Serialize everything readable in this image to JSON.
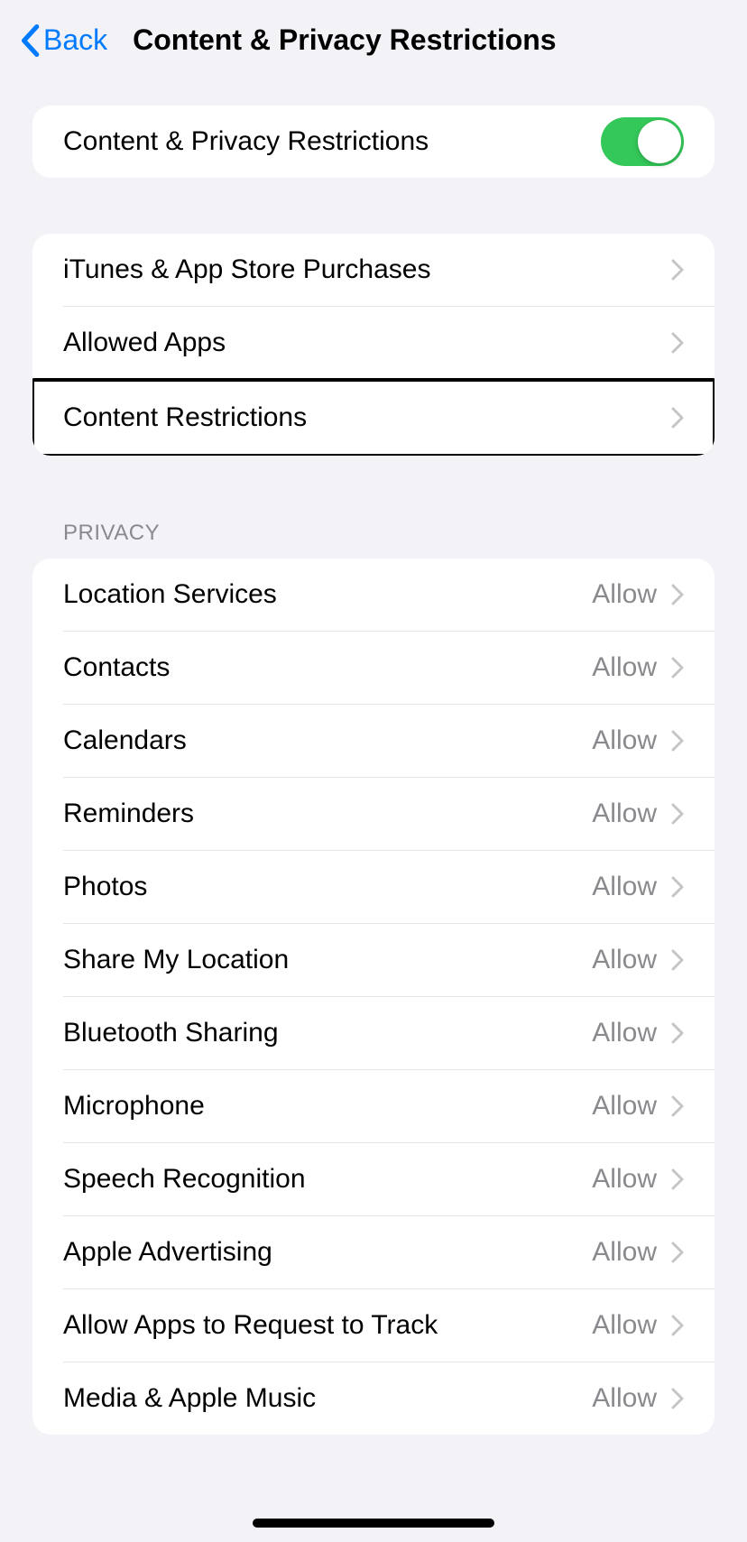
{
  "header": {
    "back_label": "Back",
    "title": "Content & Privacy Restrictions"
  },
  "toggle_section": {
    "label": "Content & Privacy Restrictions",
    "enabled": true
  },
  "nav_section": {
    "items": [
      {
        "label": "iTunes & App Store Purchases"
      },
      {
        "label": "Allowed Apps"
      },
      {
        "label": "Content Restrictions",
        "highlighted": true
      }
    ]
  },
  "privacy_section": {
    "header": "Privacy",
    "items": [
      {
        "label": "Location Services",
        "value": "Allow"
      },
      {
        "label": "Contacts",
        "value": "Allow"
      },
      {
        "label": "Calendars",
        "value": "Allow"
      },
      {
        "label": "Reminders",
        "value": "Allow"
      },
      {
        "label": "Photos",
        "value": "Allow"
      },
      {
        "label": "Share My Location",
        "value": "Allow"
      },
      {
        "label": "Bluetooth Sharing",
        "value": "Allow"
      },
      {
        "label": "Microphone",
        "value": "Allow"
      },
      {
        "label": "Speech Recognition",
        "value": "Allow"
      },
      {
        "label": "Apple Advertising",
        "value": "Allow"
      },
      {
        "label": "Allow Apps to Request to Track",
        "value": "Allow"
      },
      {
        "label": "Media & Apple Music",
        "value": "Allow"
      }
    ]
  }
}
